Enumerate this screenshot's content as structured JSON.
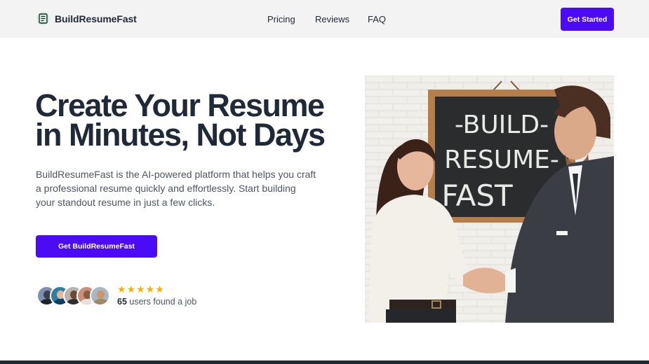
{
  "header": {
    "brand": "BuildResumeFast",
    "nav": [
      "Pricing",
      "Reviews",
      "FAQ"
    ],
    "cta": "Get Started"
  },
  "hero": {
    "headline_line1": "Create Your Resume",
    "headline_line2": "in Minutes, Not Days",
    "lead": "BuildResumeFast is the AI-powered platform that helps you craft a professional resume quickly and effortlessly. Start building your standout resume in just a few clicks.",
    "cta": "Get BuildResumeFast",
    "rating_stars": 5,
    "user_count": "65",
    "user_text": "users found a job"
  },
  "image": {
    "chalkboard_line1": "-BUILD-",
    "chalkboard_line2": "RESUME-",
    "chalkboard_line3": "FAST"
  },
  "colors": {
    "accent": "#4c0bf5",
    "star": "#f5b301",
    "header_bg": "#f3f3f3",
    "footer": "#1f2a33"
  }
}
